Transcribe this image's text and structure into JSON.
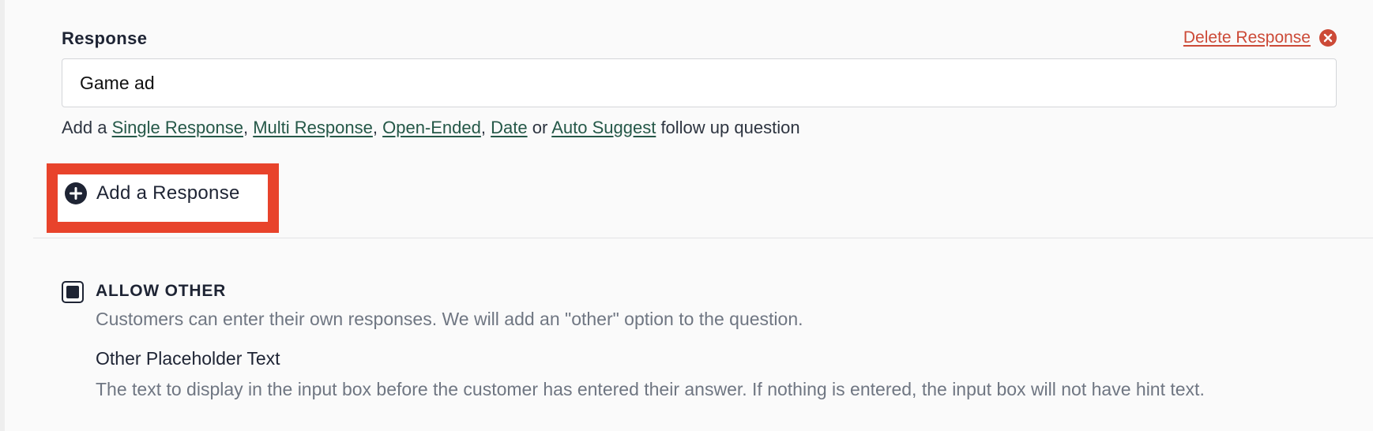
{
  "response": {
    "label": "Response",
    "value": "Game ad",
    "delete_label": "Delete Response"
  },
  "followup": {
    "prefix": "Add a",
    "links": [
      "Single Response",
      "Multi Response",
      "Open-Ended",
      "Date",
      "Auto Suggest"
    ],
    "sep1": ",",
    "sep2": ",",
    "sep3": ",",
    "or": "or",
    "suffix": "follow up question"
  },
  "add_response": {
    "label": "Add a Response"
  },
  "allow_other": {
    "checked": true,
    "title": "ALLOW OTHER",
    "description": "Customers can enter their own responses. We will add an \"other\" option to the question.",
    "placeholder_title": "Other Placeholder Text",
    "placeholder_description": "The text to display in the input box before the customer has entered their answer. If nothing is entered, the input box will not have hint text."
  },
  "colors": {
    "link": "#255848",
    "delete": "#cc4a37",
    "highlight": "#e8432b",
    "text_dark": "#1e2434",
    "text_muted": "#6f7682"
  },
  "icons": {
    "delete": "close-circle-icon",
    "add": "plus-circle-icon"
  }
}
